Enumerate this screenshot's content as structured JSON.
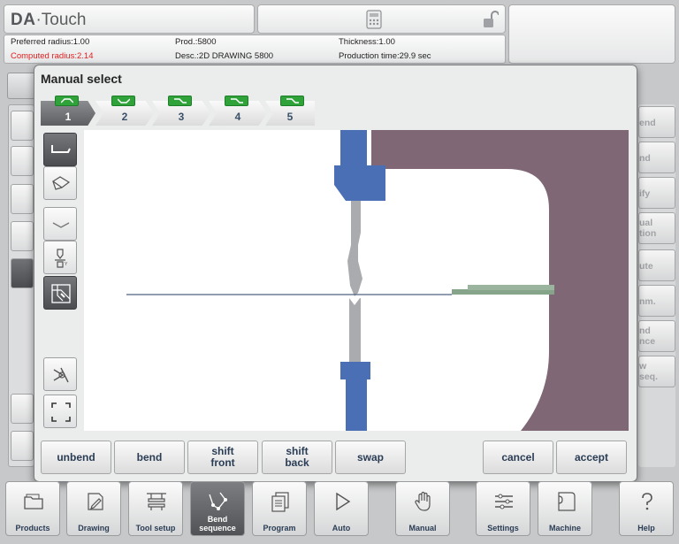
{
  "header": {
    "logo_brand": "DA",
    "logo_product": "Touch",
    "preferred_radius": "Preferred radius:1.00",
    "computed_radius": "Computed radius:2.14",
    "prod": "Prod.:5800",
    "desc": "Desc.:2D DRAWING 5800",
    "thickness": "Thickness:1.00",
    "production_time": "Production time:29.9 sec",
    "icons": [
      "calculator-icon",
      "lock-open-icon"
    ]
  },
  "background_panel": {
    "right_buttons": [
      "end",
      "nd",
      "ify",
      "ual\ntion",
      "ute",
      "nm.",
      "nd\nnce",
      "w\nseq."
    ]
  },
  "dialog": {
    "title": "Manual select",
    "steps": [
      {
        "label": "1",
        "active": true
      },
      {
        "label": "2",
        "active": false
      },
      {
        "label": "3",
        "active": false
      },
      {
        "label": "4",
        "active": false
      },
      {
        "label": "5",
        "active": false
      }
    ],
    "tool_icons": [
      "flange-back-icon",
      "3d-view-icon",
      "bend-down-icon",
      "tool-press-icon",
      "machine-view-icon",
      "zoom-fit-icon",
      "select-area-icon"
    ],
    "buttons": {
      "unbend": "unbend",
      "bend": "bend",
      "shift_front": "shift\nfront",
      "shift_back": "shift\nback",
      "swap": "swap",
      "cancel": "cancel",
      "accept": "accept"
    },
    "colors": {
      "tool_blue": "#4a6fb5",
      "tool_grey": "#a9abae",
      "machine_mauve": "#7f6776",
      "sheet_green": "#86a48a",
      "step_badge": "#2fa33a"
    }
  },
  "nav": {
    "items": [
      {
        "label": "Products",
        "icon": "folder-icon"
      },
      {
        "label": "Drawing",
        "icon": "pencil-icon"
      },
      {
        "label": "Tool setup",
        "icon": "tool-setup-icon"
      },
      {
        "label": "Bend\nsequence",
        "icon": "bend-sequence-icon",
        "active": true
      },
      {
        "label": "Program",
        "icon": "program-icon"
      },
      {
        "label": "Auto",
        "icon": "play-icon"
      },
      {
        "label": "Manual",
        "icon": "hand-icon"
      },
      {
        "label": "Settings",
        "icon": "settings-list-icon"
      },
      {
        "label": "Machine",
        "icon": "machine-icon"
      },
      {
        "label": "Help",
        "icon": "help-icon"
      }
    ]
  }
}
